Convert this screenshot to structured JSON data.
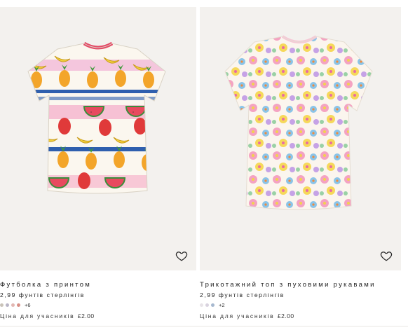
{
  "products": [
    {
      "title": "Футболка з принтом",
      "price": "2,99 фунтів стерлінгів",
      "swatch_colors": [
        "#c9c3b8",
        "#b9b5c6",
        "#e2b7b2",
        "#d88f86"
      ],
      "more_colors": "+6",
      "member_label": "Ціна для учасників",
      "member_price": "£2.00",
      "image_icon": "fruit-print-tshirt",
      "favorite_icon": "heart-outline-icon"
    },
    {
      "title": "Трикотажний топ з пуховими рукавами",
      "price": "2,99 фунтів стерлінгів",
      "swatch_colors": [
        "#e8e4e8",
        "#d9d3df",
        "#a6b8cf"
      ],
      "more_colors": "+2",
      "member_label": "Ціна для учасників",
      "member_price": "£2.00",
      "image_icon": "floral-print-top",
      "favorite_icon": "heart-outline-icon"
    }
  ]
}
